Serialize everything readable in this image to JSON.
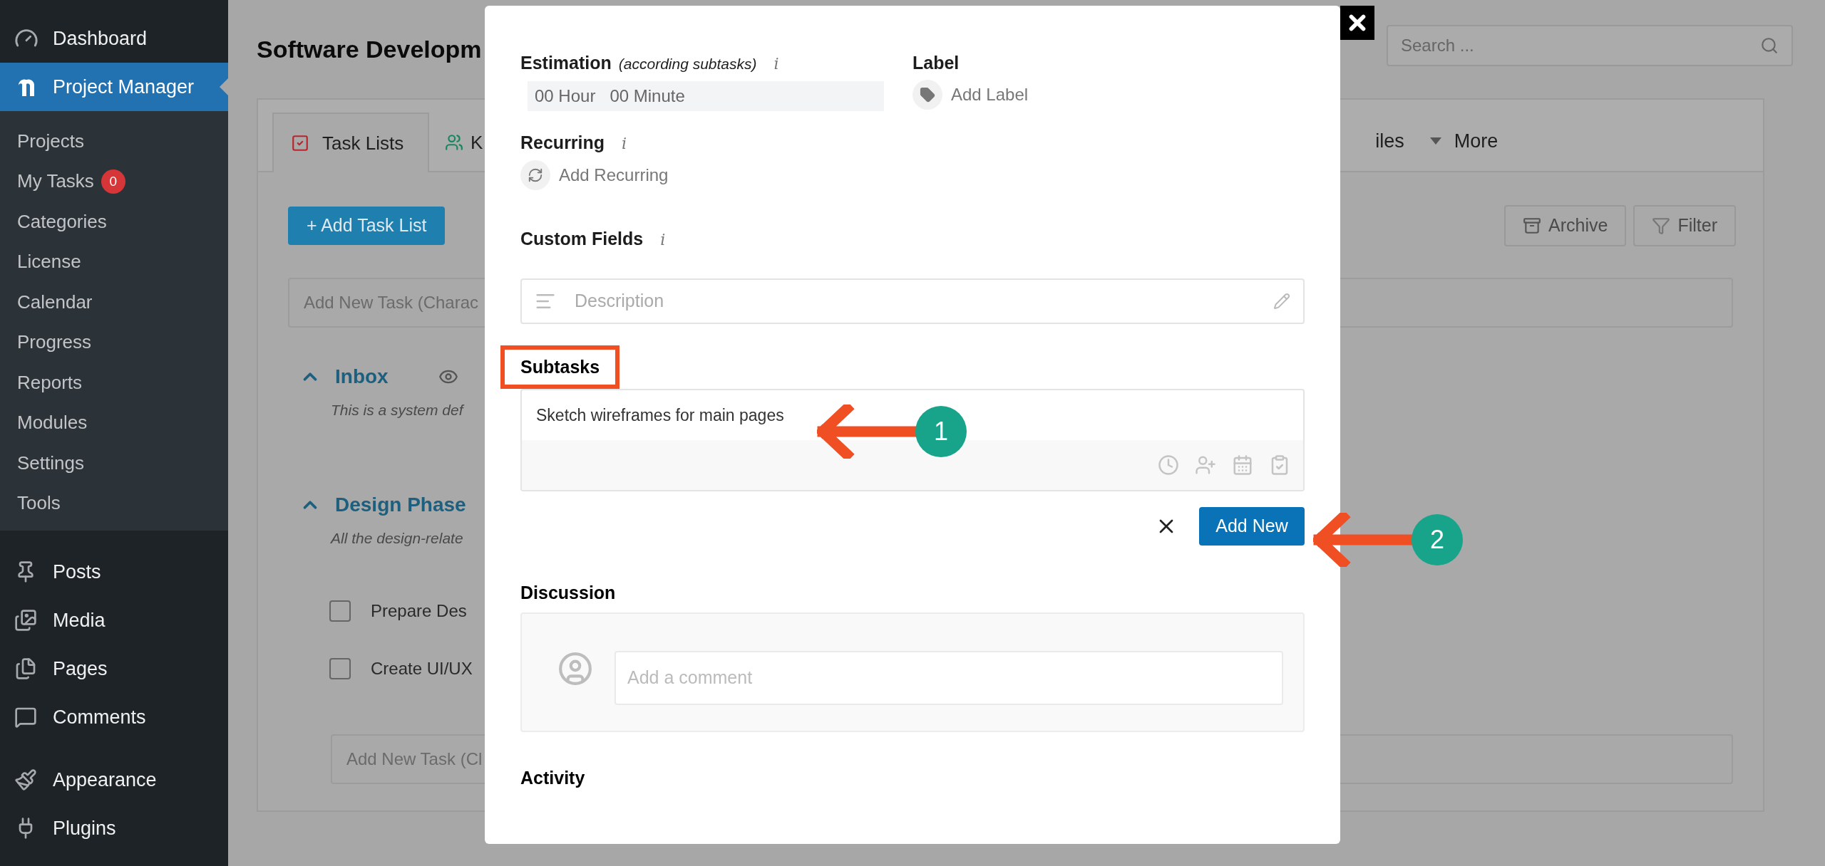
{
  "sidebar": {
    "top_items": [
      {
        "label": "Dashboard",
        "selected": false
      },
      {
        "label": "Project Manager",
        "selected": true
      }
    ],
    "submenu": [
      {
        "label": "Projects"
      },
      {
        "label": "My Tasks",
        "badge": "0"
      },
      {
        "label": "Categories"
      },
      {
        "label": "License"
      },
      {
        "label": "Calendar"
      },
      {
        "label": "Progress"
      },
      {
        "label": "Reports"
      },
      {
        "label": "Modules"
      },
      {
        "label": "Settings"
      },
      {
        "label": "Tools"
      }
    ],
    "bottom_groups": [
      {
        "items": [
          "Posts",
          "Media",
          "Pages",
          "Comments"
        ]
      },
      {
        "items": [
          "Appearance",
          "Plugins"
        ]
      }
    ]
  },
  "page": {
    "title": "Software Developm",
    "search": {
      "placeholder": "Search ..."
    },
    "tabs_left": [
      {
        "label": "Task Lists",
        "selected": true
      },
      {
        "label": "K",
        "selected": false
      }
    ],
    "tabs_right": [
      {
        "label": "iles",
        "kind": "tab"
      },
      {
        "label": "More",
        "kind": "dropdown"
      }
    ],
    "add_list_button": "+ Add Task List",
    "archive_button": "Archive",
    "filter_button": "Filter",
    "new_task_placeholder": "Add New Task (Charac",
    "lists": [
      {
        "title": "Inbox",
        "description": "This is a system def",
        "watch": true
      },
      {
        "title": "Design Phase",
        "description": "All the design-relate",
        "watch": false,
        "tasks": [
          {
            "title": "Prepare Des",
            "checked": false
          },
          {
            "title": "Create UI/UX",
            "checked": false
          }
        ]
      }
    ],
    "list_task_placeholder": "Add New Task (Cl"
  },
  "modal": {
    "estimation": {
      "label": "Estimation",
      "hint": "(according subtasks)",
      "info": "i",
      "hours": "00 Hour",
      "minutes": "00 Minute"
    },
    "label": {
      "label": "Label",
      "action": "Add Label"
    },
    "recurring": {
      "label": "Recurring",
      "info": "i",
      "action": "Add Recurring"
    },
    "custom_fields": {
      "label": "Custom Fields",
      "info": "i"
    },
    "description_placeholder": "Description",
    "subtasks": {
      "label": "Subtasks",
      "value": "Sketch wireframes for main pages",
      "add_button": "Add New"
    },
    "discussion": {
      "label": "Discussion",
      "placeholder": "Add a comment"
    },
    "activity": {
      "label": "Activity"
    }
  },
  "annotations": [
    {
      "number": "1"
    },
    {
      "number": "2"
    }
  ]
}
